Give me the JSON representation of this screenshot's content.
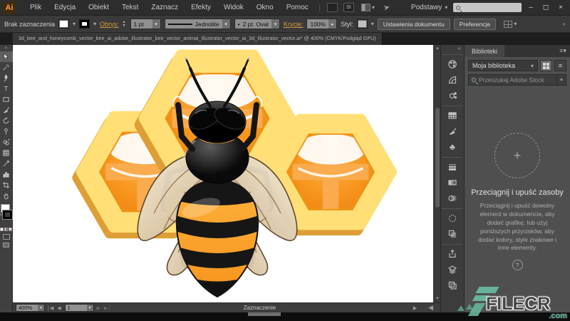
{
  "titlebar": {
    "app_logo": "Ai",
    "menus": [
      "Plik",
      "Edycja",
      "Obiekt",
      "Tekst",
      "Zaznacz",
      "Efekty",
      "Widok",
      "Okno",
      "Pomoc"
    ],
    "stock_button": "St",
    "workspace_label": "Podstawy",
    "search_placeholder": "",
    "window": {
      "minimize": "–",
      "restore": "◻",
      "close": "×"
    }
  },
  "control_bar": {
    "selection_status": "Brak zaznaczenia",
    "stroke_link": "Obrys:",
    "stroke_weight": "1 pt",
    "stroke_variable": "Jednolite",
    "brush_definition": "2 pt. Oval",
    "opacity_link": "Krycie:",
    "opacity_value": "100%",
    "style_label": "Styl:",
    "document_setup_button": "Ustawienia dokumentu",
    "preferences_button": "Preferencje"
  },
  "document_tab": {
    "title": "3d_bee_and_honeycomb_vector_bee_ai_adobe_illustrator_bee_vector_animal_illustrator_vector_ai_3d_illustrator_vector.ai* @ 400% (CMYK/Podgląd GPU)"
  },
  "toolbar": {
    "active_tool": "selection",
    "tools": [
      "selection",
      "magic-wand",
      "pen",
      "type",
      "rectangle",
      "paintbrush",
      "rotate",
      "puppet-warp",
      "shape-builder",
      "mesh",
      "eyedropper",
      "graph",
      "artboard",
      "hand"
    ]
  },
  "right_dock": {
    "panels": [
      "color",
      "color-guide",
      "recolor-artwork",
      "swatches",
      "brushes",
      "symbols",
      "stroke",
      "gradient",
      "transparency",
      "appearance",
      "graphic-styles",
      "asset-export",
      "layers",
      "artboards"
    ]
  },
  "library_panel": {
    "tab_title": "Biblioteki",
    "library_name": "Moja biblioteka",
    "search_placeholder": "Przeszukaj Adobe Stock",
    "drop_plus": "+",
    "empty_state_title": "Przeciągnij i upuść zasoby",
    "empty_state_body": "Przeciągnij i upuść dowolny element w dokumencie, aby dodać grafikę, lub użyj poniższych przycisków, aby dodać kolory, style znakowe i inne elementy.",
    "help_glyph": "?"
  },
  "status_bar": {
    "zoom_level": "400%",
    "artboard_number": "1",
    "status_label": "Zaznaczenie"
  },
  "canvas": {
    "artwork": "bee-and-honeycomb-vector"
  },
  "watermark": {
    "site": "FILECR",
    "tld": ".com"
  },
  "colors": {
    "accent_link": "#d79b3f",
    "titlebar_bg": "#2d2d2d",
    "panel_bg": "#4f4f4f",
    "hex_outer": "#ffdf76",
    "hex_inner": "#f7941d",
    "hex_shadow": "#dd9f35",
    "bee_yellow": "#fbb040",
    "wing_beige": "#e9dfc9",
    "watermark_teal": "#66b29b"
  }
}
